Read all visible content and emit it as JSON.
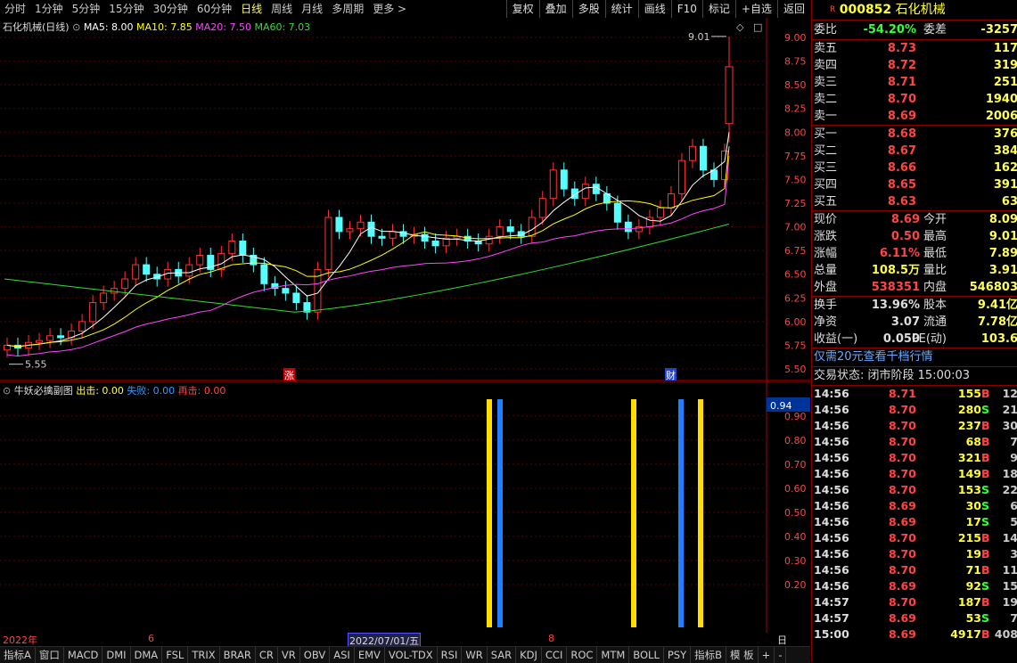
{
  "periods": [
    "分时",
    "1分钟",
    "5分钟",
    "15分钟",
    "30分钟",
    "60分钟",
    "日线",
    "周线",
    "月线",
    "多周期",
    "更多 >"
  ],
  "active_period": "日线",
  "tools": [
    "复权",
    "叠加",
    "多股",
    "统计",
    "画线",
    "F10",
    "标记",
    "+自选",
    "返回"
  ],
  "legend": {
    "name": "石化机械(日线)",
    "ma5": "MA5: 8.00",
    "ma10": "MA10: 7.85",
    "ma20": "MA20: 7.50",
    "ma60": "MA60: 7.03",
    "colors": {
      "ma5": "#ffffff",
      "ma10": "#ffff00",
      "ma20": "#ff44ff",
      "ma60": "#33dd33"
    }
  },
  "price_axis": [
    "9.00",
    "8.75",
    "8.50",
    "8.25",
    "8.00",
    "7.75",
    "7.50",
    "7.25",
    "7.00",
    "6.75",
    "6.50",
    "6.25",
    "6.00",
    "5.75",
    "5.50"
  ],
  "annotations": {
    "high": "9.01",
    "low": "5.55",
    "mark_up": "涨",
    "mark_fin": "财"
  },
  "sub": {
    "title": "牛妖必擒副图",
    "out_label": "出击: 0.00",
    "fail_label": "失败: 0.00",
    "again_label": "再击: 0.00",
    "axis": [
      "0.90",
      "0.80",
      "0.70",
      "0.60",
      "0.50",
      "0.40",
      "0.30",
      "0.20"
    ],
    "current": "0.94"
  },
  "date_axis": {
    "year": "2022年",
    "m6": "6",
    "cursor": "2022/07/01/五",
    "m8": "8",
    "period": "日线"
  },
  "bottom_tabs": [
    "指标A",
    "窗口",
    "MACD",
    "DMI",
    "DMA",
    "FSL",
    "TRIX",
    "BRAR",
    "CR",
    "VR",
    "OBV",
    "ASI",
    "EMV",
    "VOL-TDX",
    "RSI",
    "WR",
    "SAR",
    "KDJ",
    "CCI",
    "ROC",
    "MTM",
    "BOLL",
    "PSY",
    "指标B",
    "模 板",
    "+",
    "-"
  ],
  "quote": {
    "code": "000852",
    "name": "石化机械",
    "webi_label": "委比",
    "webi": "-54.20%",
    "wecha_label": "委差",
    "wecha": "-3257",
    "asks": [
      {
        "label": "卖五",
        "price": "8.73",
        "vol": "117"
      },
      {
        "label": "卖四",
        "price": "8.72",
        "vol": "319"
      },
      {
        "label": "卖三",
        "price": "8.71",
        "vol": "251"
      },
      {
        "label": "卖二",
        "price": "8.70",
        "vol": "1940"
      },
      {
        "label": "卖一",
        "price": "8.69",
        "vol": "2006"
      }
    ],
    "bids": [
      {
        "label": "买一",
        "price": "8.68",
        "vol": "376"
      },
      {
        "label": "买二",
        "price": "8.67",
        "vol": "384"
      },
      {
        "label": "买三",
        "price": "8.66",
        "vol": "162"
      },
      {
        "label": "买四",
        "price": "8.65",
        "vol": "391"
      },
      {
        "label": "买五",
        "price": "8.63",
        "vol": "63"
      }
    ],
    "stats1": [
      {
        "l1": "现价",
        "v1": "8.69",
        "l2": "今开",
        "v2": "8.09"
      },
      {
        "l1": "涨跌",
        "v1": "0.50",
        "l2": "最高",
        "v2": "9.01"
      },
      {
        "l1": "涨幅",
        "v1": "6.11%",
        "l2": "最低",
        "v2": "7.89"
      },
      {
        "l1": "总量",
        "v1": "108.5万",
        "l2": "量比",
        "v2": "3.91"
      },
      {
        "l1": "外盘",
        "v1": "538351",
        "l2": "内盘",
        "v2": "546803"
      }
    ],
    "stats2": [
      {
        "l1": "换手",
        "v1": "13.96%",
        "l2": "股本",
        "v2": "9.41亿"
      },
      {
        "l1": "净资",
        "v1": "3.07",
        "l2": "流通",
        "v2": "7.78亿"
      },
      {
        "l1": "收益(一)",
        "v1": "0.050",
        "l2": "PE(动)",
        "v2": "103.6"
      }
    ],
    "promo": "仅需20元查看千档行情",
    "status": "交易状态: 闭市阶段 15:00:03",
    "ticks": [
      {
        "t": "14:56",
        "p": "8.71",
        "v": "155",
        "bs": "B",
        "n": "12"
      },
      {
        "t": "14:56",
        "p": "8.70",
        "v": "280",
        "bs": "S",
        "n": "21"
      },
      {
        "t": "14:56",
        "p": "8.70",
        "v": "237",
        "bs": "B",
        "n": "30"
      },
      {
        "t": "14:56",
        "p": "8.70",
        "v": "68",
        "bs": "B",
        "n": "7"
      },
      {
        "t": "14:56",
        "p": "8.70",
        "v": "321",
        "bs": "B",
        "n": "9"
      },
      {
        "t": "14:56",
        "p": "8.70",
        "v": "149",
        "bs": "B",
        "n": "18"
      },
      {
        "t": "14:56",
        "p": "8.70",
        "v": "153",
        "bs": "S",
        "n": "22"
      },
      {
        "t": "14:56",
        "p": "8.69",
        "v": "30",
        "bs": "S",
        "n": "6"
      },
      {
        "t": "14:56",
        "p": "8.69",
        "v": "17",
        "bs": "S",
        "n": "5"
      },
      {
        "t": "14:56",
        "p": "8.70",
        "v": "215",
        "bs": "B",
        "n": "14"
      },
      {
        "t": "14:56",
        "p": "8.70",
        "v": "19",
        "bs": "B",
        "n": "3"
      },
      {
        "t": "14:56",
        "p": "8.70",
        "v": "71",
        "bs": "B",
        "n": "11"
      },
      {
        "t": "14:56",
        "p": "8.69",
        "v": "92",
        "bs": "S",
        "n": "15"
      },
      {
        "t": "14:57",
        "p": "8.70",
        "v": "187",
        "bs": "B",
        "n": "19"
      },
      {
        "t": "14:57",
        "p": "8.69",
        "v": "53",
        "bs": "S",
        "n": "7"
      },
      {
        "t": "15:00",
        "p": "8.69",
        "v": "4917",
        "bs": "B",
        "n": "408"
      }
    ]
  }
}
